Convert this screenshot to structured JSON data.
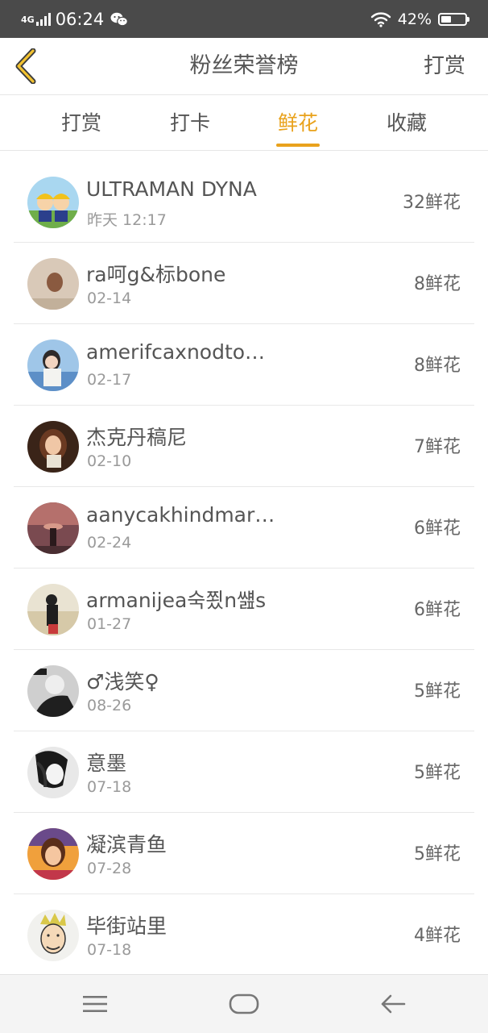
{
  "status_bar": {
    "network": "4G",
    "time": "06:24",
    "battery_text": "42%",
    "battery_level": 0.42,
    "icons": [
      "signal-icon",
      "wechat-icon",
      "wifi-icon",
      "battery-icon"
    ]
  },
  "header": {
    "title": "粉丝荣誉榜",
    "back_icon": "chevron-left-icon",
    "action_label": "打赏"
  },
  "tabs": [
    {
      "label": "打赏",
      "active": false
    },
    {
      "label": "打卡",
      "active": false
    },
    {
      "label": "鲜花",
      "active": true
    },
    {
      "label": "收藏",
      "active": false
    }
  ],
  "fans": [
    {
      "name": "ULTRAMAN DYNA",
      "date": "昨天 12:17",
      "count": "32鲜花"
    },
    {
      "name": "ra呵g&标bone",
      "date": "02-14",
      "count": "8鲜花"
    },
    {
      "name": "amerifcaxnodto…",
      "date": "02-17",
      "count": "8鲜花"
    },
    {
      "name": "杰克丹稿尼",
      "date": "02-10",
      "count": "7鲜花"
    },
    {
      "name": "aanycakhindmar…",
      "date": "02-24",
      "count": "6鲜花"
    },
    {
      "name": "armanijea숙쬤n썚s",
      "date": "01-27",
      "count": "6鲜花"
    },
    {
      "name": "♂浅笑♀",
      "date": "08-26",
      "count": "5鲜花"
    },
    {
      "name": "意墨",
      "date": "07-18",
      "count": "5鲜花"
    },
    {
      "name": "凝滨青鱼",
      "date": "07-28",
      "count": "5鲜花"
    },
    {
      "name": "毕街站里",
      "date": "07-18",
      "count": "4鲜花"
    }
  ],
  "nav_bar": {
    "icons": [
      "menu-icon",
      "home-icon",
      "back-arrow-icon"
    ]
  },
  "colors": {
    "accent": "#e9a21c",
    "status_bar_bg": "#4a4a4a",
    "divider": "#e8e8e8"
  }
}
